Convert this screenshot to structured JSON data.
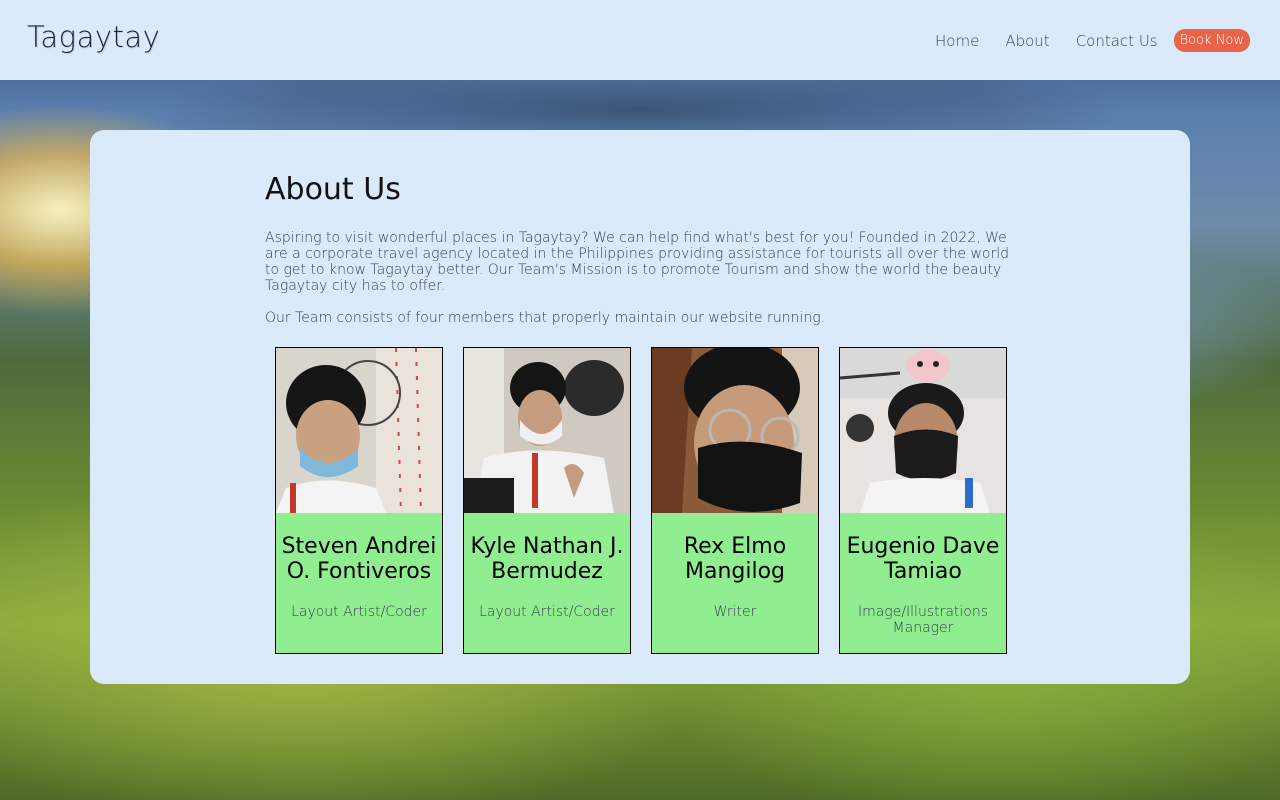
{
  "site": {
    "logo": "Tagaytay"
  },
  "nav": {
    "home": "Home",
    "about": "About",
    "contact": "Contact Us",
    "book": "Book Now"
  },
  "about": {
    "title": "About Us",
    "paragraph1": "Aspiring to visit wonderful places in Tagaytay? We can help find what's best for you! Founded in 2022, We are a corporate travel agency located in the Philippines providing assistance for tourists all over the world to get to know Tagaytay better. Our Team's Mission is to promote Tourism and show the world the beauty Tagaytay city has to offer.",
    "paragraph2": "Our Team consists of four members that properly maintain our website running."
  },
  "team": [
    {
      "name": "Steven Andrei O. Fontiveros",
      "role": "Layout Artist/Coder"
    },
    {
      "name": "Kyle Nathan J. Bermudez",
      "role": "Layout Artist/Coder"
    },
    {
      "name": "Rex Elmo Mangilog",
      "role": "Writer"
    },
    {
      "name": "Eugenio Dave Tamiao",
      "role": "Image/Illustrations Manager"
    }
  ],
  "colors": {
    "header_bg": "#dbeafb",
    "card_bg": "#90ee90",
    "book_button": "#e8634a"
  }
}
